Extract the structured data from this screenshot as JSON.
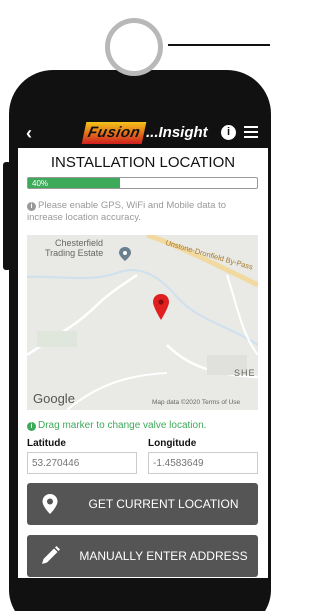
{
  "header": {
    "logo_mark": "Fusion",
    "logo_text": "...Insight"
  },
  "page": {
    "title": "INSTALLATION LOCATION",
    "progress_label": "40%",
    "progress_fraction": 0.4,
    "notice": "Please enable GPS, WiFi and Mobile data to increase location accuracy."
  },
  "map": {
    "labels": [
      "Chesterfield",
      "Trading Estate",
      "Unstone-Dronfield By-Pass",
      "SHE"
    ],
    "brand": "Google",
    "attribution": "Map data ©2020   Terms of Use"
  },
  "hint": "Drag marker to change valve location.",
  "latitude": {
    "label": "Latitude",
    "placeholder": "53.270446"
  },
  "longitude": {
    "label": "Longitude",
    "placeholder": "-1.4583649"
  },
  "buttons": {
    "current": "GET CURRENT LOCATION",
    "manual": "MANUALLY ENTER ADDRESS"
  },
  "colors": {
    "accent_green": "#3daa5a",
    "button_gray": "#555555",
    "marker_red": "#e02020"
  }
}
